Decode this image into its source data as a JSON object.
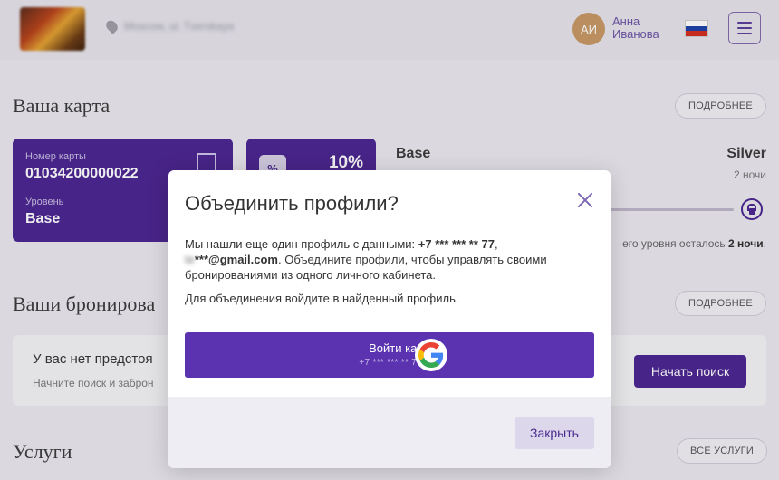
{
  "header": {
    "location": "Moscow, ul. Tverskaya",
    "avatar_initials": "АИ",
    "user_first_name": "Анна",
    "user_last_name": "Иванова"
  },
  "card_section": {
    "title": "Ваша карта",
    "details_label": "ПОДРОБНЕЕ",
    "card_number_label": "Номер карты",
    "card_number": "01034200000022",
    "level_label": "Уровень",
    "level_value": "Base",
    "discount": "10%",
    "discount_icon": "%",
    "current_level": "Base",
    "next_level": "Silver",
    "next_level_nights": "2 ночи",
    "progress_fraction": 0,
    "remaining_text": "его уровня осталось ",
    "remaining_nights": "2 ночи",
    "remaining_suffix": "."
  },
  "bookings_section": {
    "title": "Ваши бронирова",
    "details_label": "ПОДРОБНЕЕ",
    "empty_title": "У вас нет предстоя",
    "empty_subtitle": "Начните поиск и заброн",
    "search_button": "Начать поиск"
  },
  "services_section": {
    "title": "Услуги",
    "all_label": "ВСЕ УСЛУГИ"
  },
  "modal": {
    "title": "Объединить профили?",
    "text_prefix": "Мы нашли еще один профиль с данными: ",
    "phone_masked": "+7 *** *** ** 77",
    "text_comma": ",",
    "email_masked_prefix": "te",
    "email_masked": "***@gmail.com",
    "text_suffix": ". Объедините профили, чтобы управлять своими бронированиями из одного личного кабинета.",
    "text2": "Для объединения войдите в найденный профиль.",
    "google_button_line1": "Войти как",
    "google_button_line2": "+7 *** *** ** 77",
    "close_button": "Закрыть"
  },
  "colors": {
    "brand_purple": "#4a248f",
    "button_purple": "#5b33b0",
    "close_icon": "#7d69b3"
  }
}
